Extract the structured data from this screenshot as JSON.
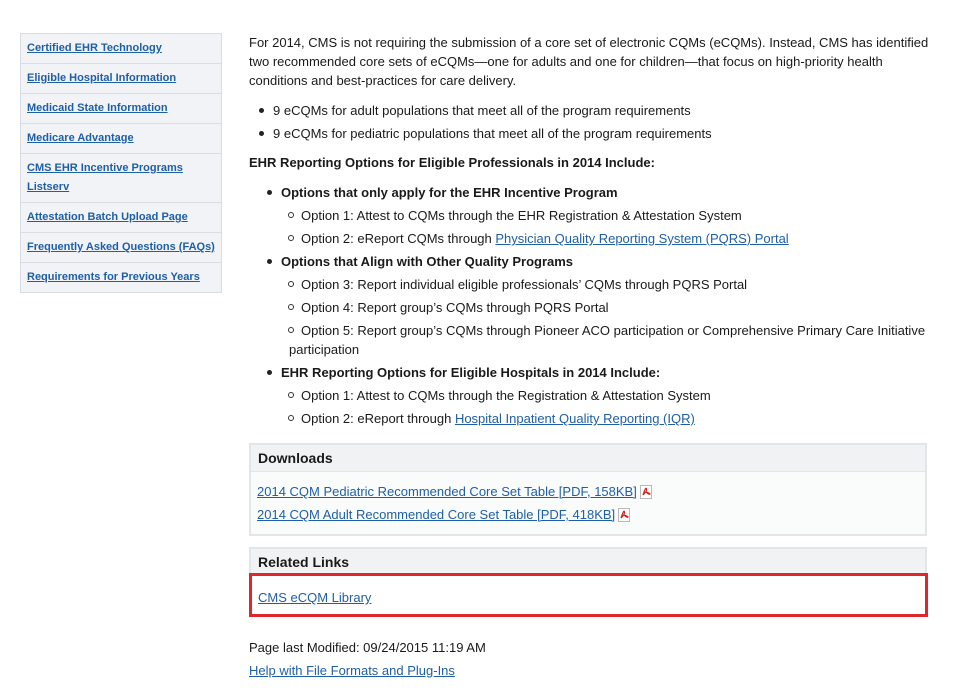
{
  "sidebar": {
    "items": [
      {
        "label": "Certified EHR Technology"
      },
      {
        "label": "Eligible Hospital Information"
      },
      {
        "label": "Medicaid State Information"
      },
      {
        "label": "Medicare Advantage"
      },
      {
        "label": "CMS EHR Incentive Programs Listserv"
      },
      {
        "label": "Attestation Batch Upload Page"
      },
      {
        "label": "Frequently Asked Questions (FAQs)"
      },
      {
        "label": "Requirements for Previous Years"
      }
    ]
  },
  "main": {
    "intro": "For 2014, CMS is not requiring the submission of a core set of electronic CQMs (eCQMs). Instead, CMS has identified two recommended core sets of eCQMs—one for adults and one for children—that focus on high-priority health conditions and best-practices for care delivery.",
    "bullets": [
      "9 eCQMs for adult populations that meet all of the program requirements",
      "9 eCQMs for pediatric populations that meet all of the program requirements"
    ],
    "heading": "EHR Reporting Options for Eligible Professionals in 2014 Include:",
    "group1": {
      "title": "Options that only apply for the EHR Incentive Program",
      "opt1": "Option 1: Attest to CQMs through the EHR Registration & Attestation System",
      "opt2_prefix": "Option 2: eReport CQMs through ",
      "opt2_link": "Physician Quality Reporting System (PQRS) Portal"
    },
    "group2": {
      "title": "Options that Align with Other Quality Programs",
      "opt3": "Option 3: Report individual eligible professionals’ CQMs through PQRS Portal",
      "opt4": "Option 4: Report group’s CQMs through PQRS Portal",
      "opt5_line1": "Option 5: Report group’s CQMs through Pioneer ACO participation or Comprehensive Primary Care Initiative",
      "opt5_line2": "participation"
    },
    "group3": {
      "title": "EHR Reporting Options for Eligible Hospitals in 2014 Include:",
      "opt1": "Option 1: Attest to CQMs through the Registration & Attestation System",
      "opt2_prefix": "Option 2: eReport through ",
      "opt2_link": "Hospital Inpatient Quality Reporting (IQR)"
    }
  },
  "downloads": {
    "title": "Downloads",
    "items": [
      {
        "label": "2014 CQM Pediatric Recommended Core Set Table [PDF, 158KB]",
        "icon": "pdf-icon"
      },
      {
        "label": "2014 CQM Adult Recommended Core Set Table [PDF, 418KB]",
        "icon": "pdf-icon"
      }
    ]
  },
  "related": {
    "title": "Related Links",
    "link": "CMS eCQM Library",
    "highlight_color": "#e0262c"
  },
  "footer": {
    "modified": "Page last Modified: 09/24/2015 11:19 AM",
    "help_link": "Help with File Formats and Plug-Ins"
  },
  "colors": {
    "link": "#1f5fa5",
    "sidebar_bg": "#f1f3f6",
    "box_border": "#e3e6e9",
    "pdf_red": "#d3231c"
  }
}
